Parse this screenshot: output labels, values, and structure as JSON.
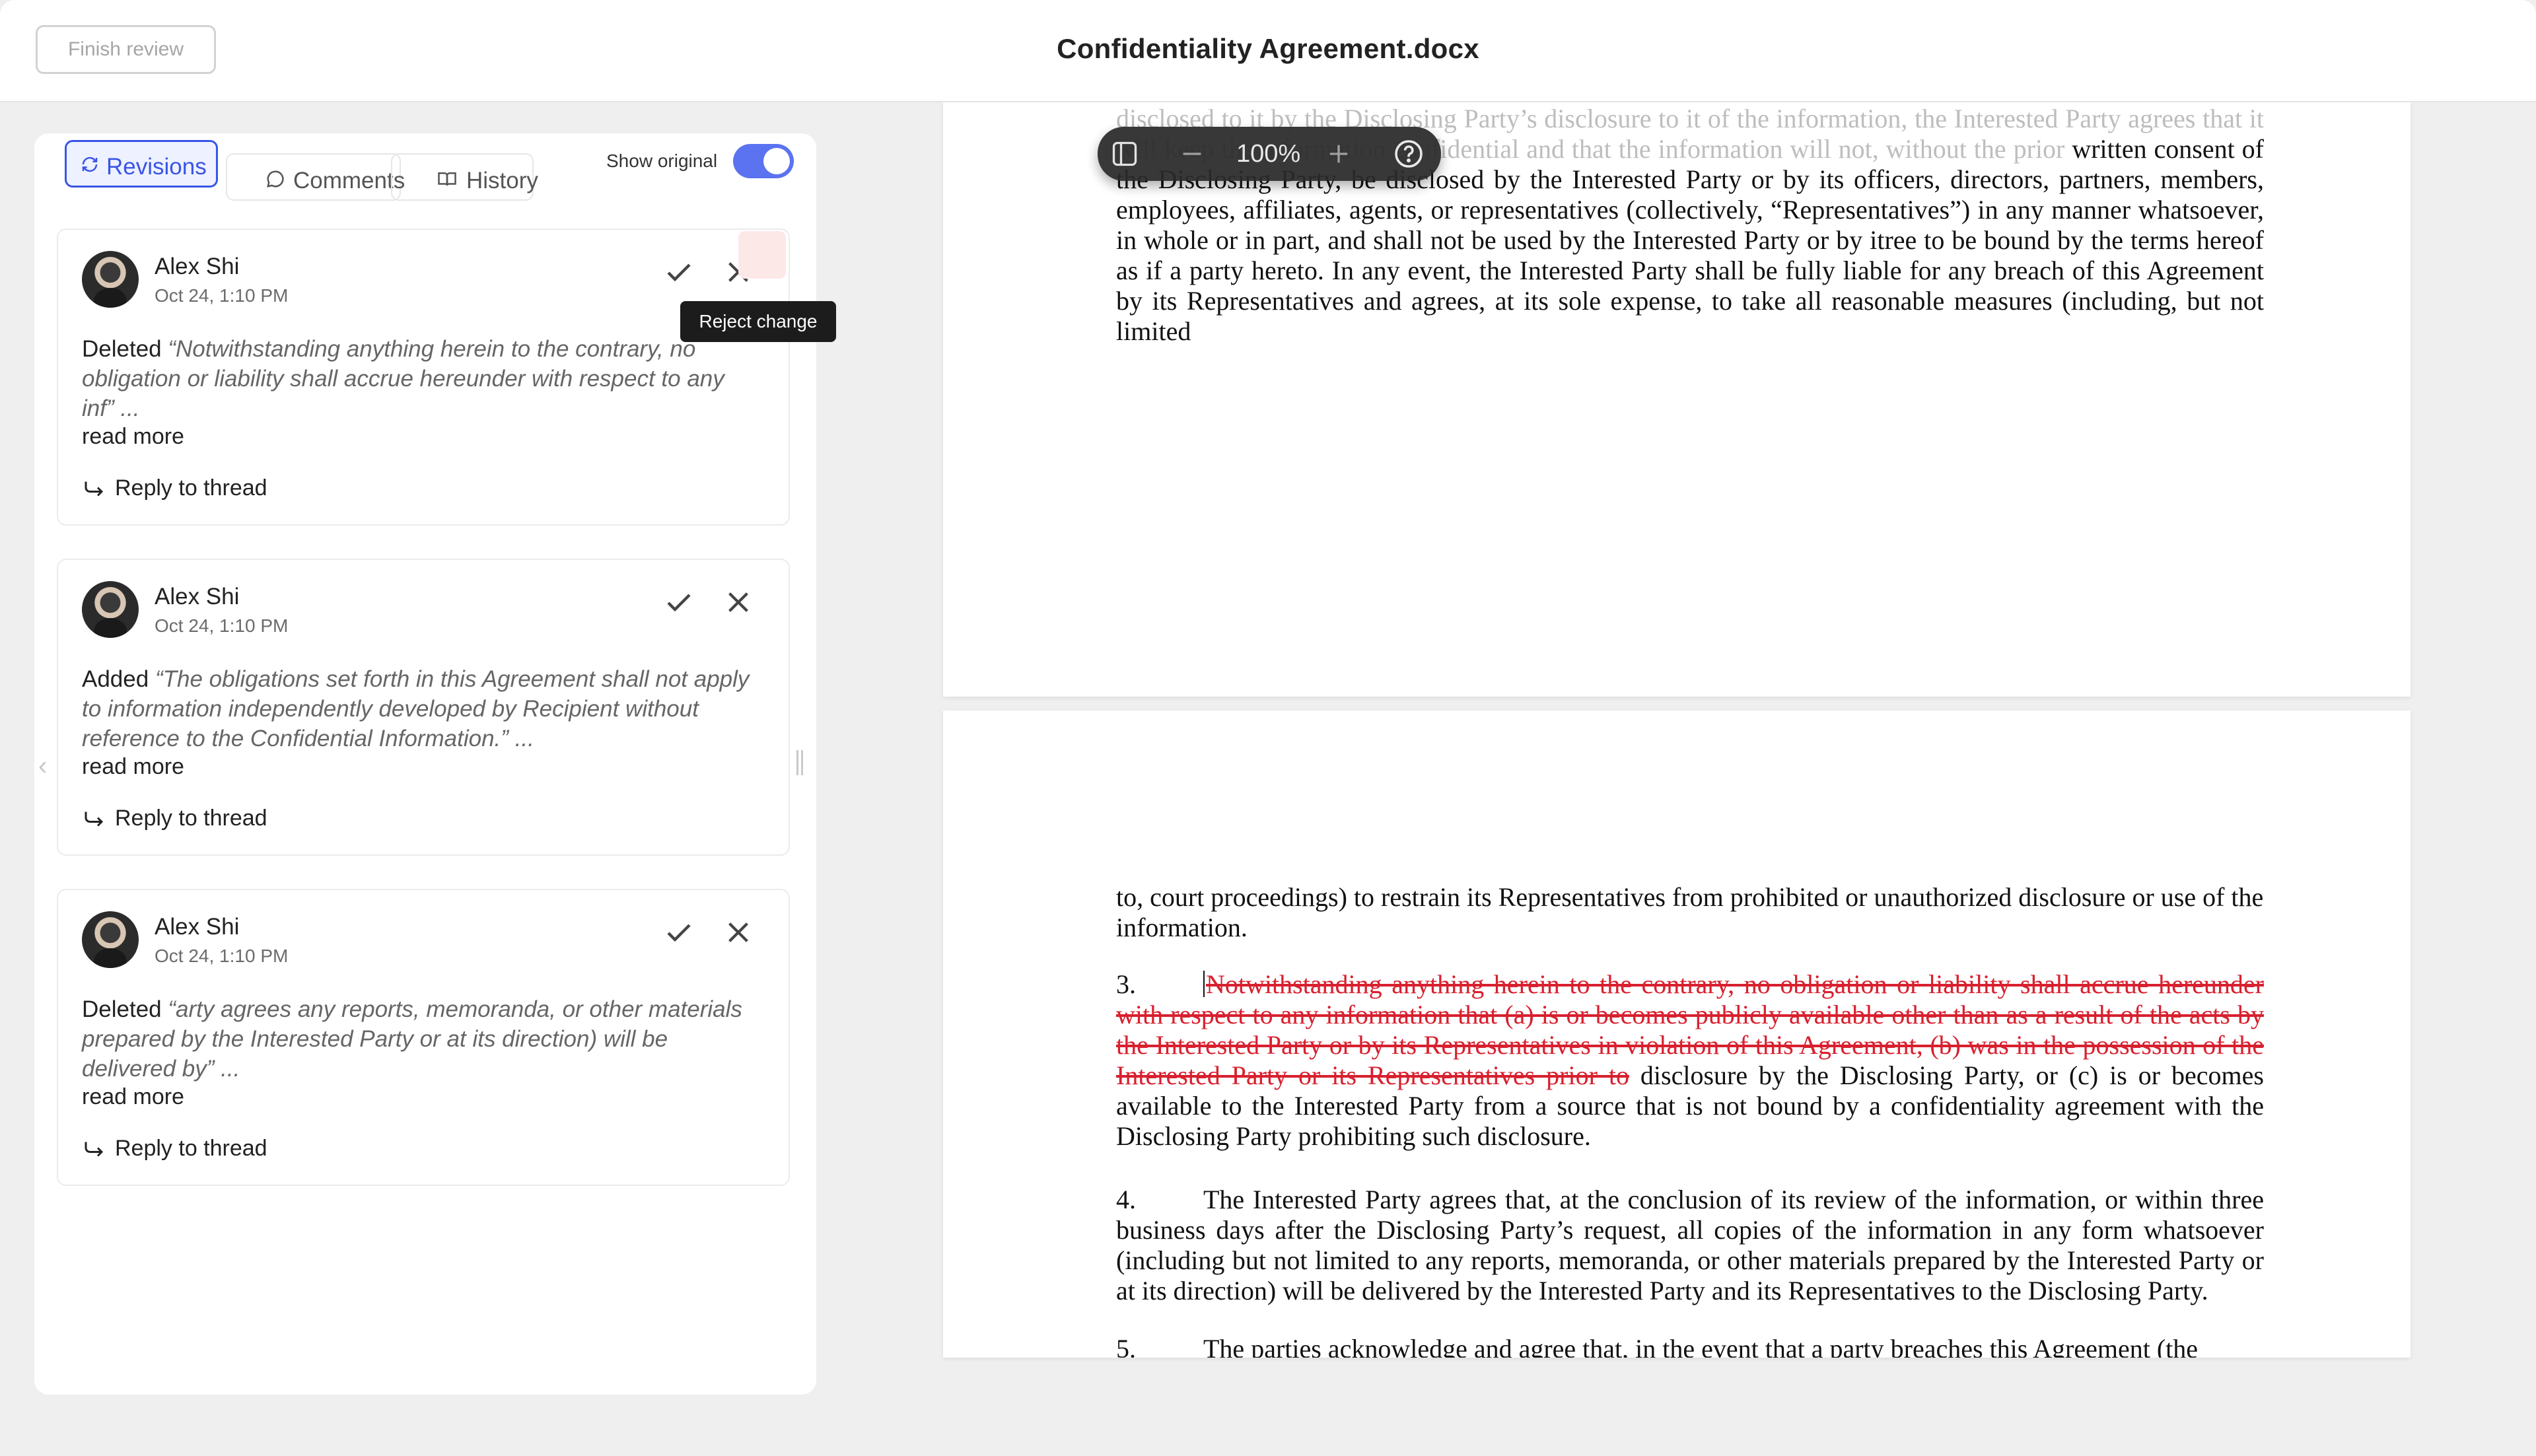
{
  "header": {
    "finish_label": "Finish review",
    "title": "Confidentiality Agreement.docx"
  },
  "panel": {
    "tabs": [
      {
        "label": "Revisions",
        "icon": "revisions-icon",
        "active": true
      },
      {
        "label": "Comments",
        "icon": "comment-icon",
        "active": false
      },
      {
        "label": "History",
        "icon": "book-icon",
        "active": false
      }
    ],
    "show_original_label": "Show original",
    "show_original_on": true,
    "tooltip": "Reject change",
    "cards": [
      {
        "author": "Alex Shi",
        "time": "Oct 24, 1:10 PM",
        "action": "Deleted",
        "quote": "“Notwithstanding anything herein to the contrary, no obligation or liability shall accrue hereunder with respect to any inf”",
        "ellipsis": " ...",
        "read_more": "read more",
        "reply": "Reply to thread"
      },
      {
        "author": "Alex Shi",
        "time": "Oct 24, 1:10 PM",
        "action": "Added",
        "quote": "“The obligations set forth in this Agreement shall not apply to information independently developed by Recipient without reference to the Confidential Information.”",
        "ellipsis": " ...",
        "read_more": "read more",
        "reply": "Reply to thread"
      },
      {
        "author": "Alex Shi",
        "time": "Oct 24, 1:10 PM",
        "action": "Deleted",
        "quote": "“arty agrees any reports, memoranda, or other materials prepared by the Interested Party or at its direction) will be delivered by”",
        "ellipsis": " ...",
        "read_more": "read more",
        "reply": "Reply to thread"
      }
    ]
  },
  "zoom": {
    "value": "100%"
  },
  "document": {
    "page1": {
      "faded": "disclosed to it by the Disclosing Party’s disclosure to it of the information, the Interested Party agrees that it will keep the information confidential and that the information will not, without the prior",
      "text": "written consent of the Disclosing Party, be disclosed by the Interested Party or by its officers, directors, partners, members, employees, affiliates, agents, or representatives (collectively, “Representatives”) in any manner whatsoever, in whole or in part, and shall not be used by the Interested Party or by itree to be bound by the terms hereof as if a party hereto. In any event, the Interested Party shall be fully liable for any breach of this Agreement by its Representatives and agrees, at its sole expense, to take all reasonable measures (including, but not limited"
    },
    "page2": {
      "para1": "to, court proceedings) to restrain its Representatives from prohibited or unauthorized disclosure or use of the information.",
      "para3_num": "3.",
      "para3_deleted": "Notwithstanding anything herein to the contrary, no obligation or liability shall accrue hereunder with respect to any information that (a) is or becomes publicly available other than as a result of the acts by the Interested Party or by its Representatives in violation of this Agreement, (b) was in the possession of the Interested Party or its Representatives prior to",
      "para3_rest": " disclosure by the Disclosing Party, or (c) is or becomes available to the Interested Party from a source that is not bound by a confidentiality agreement with the Disclosing Party prohibiting such disclosure.",
      "para4_num": "4.",
      "para4": "The Interested Party agrees that, at the conclusion of its review of the information, or within three business days after the Disclosing Party’s request, all copies of the information in any form whatsoever (including but not limited to any reports, memoranda, or other materials prepared by the Interested Party or at its direction) will be delivered by the Interested Party and its Representatives to the Disclosing Party.",
      "para5_num": "5.",
      "para5": "The parties acknowledge and agree that, in the event that a party breaches this Agreement (the"
    }
  },
  "colors": {
    "accent": "#3a55e6",
    "toggle": "#5b73f0",
    "deleted": "#d8202f"
  }
}
